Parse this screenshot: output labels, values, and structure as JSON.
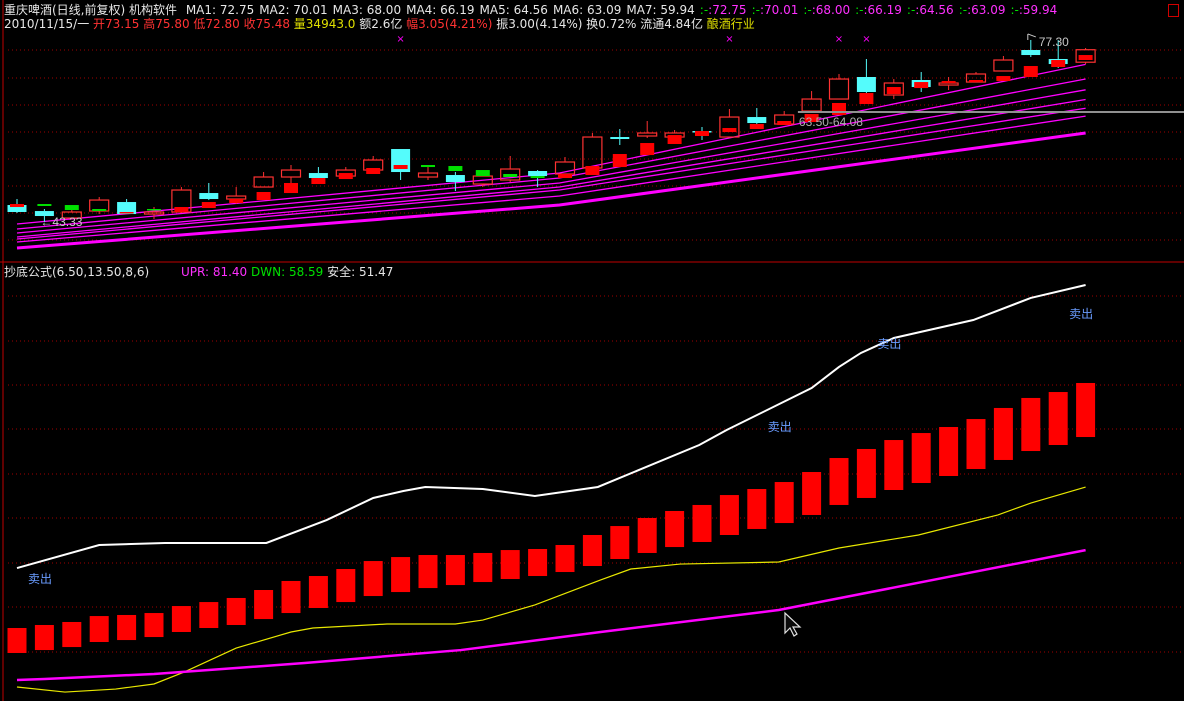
{
  "header": {
    "title": "重庆啤酒(日线,前复权) 机构软件",
    "ma": [
      {
        "label": "MA1: 72.75"
      },
      {
        "label": "MA2: 70.01"
      },
      {
        "label": "MA3: 68.00"
      },
      {
        "label": "MA4: 66.19"
      },
      {
        "label": "MA5: 64.56"
      },
      {
        "label": "MA6: 63.09"
      },
      {
        "label": "MA7: 59.94"
      }
    ],
    "ma_extra": [
      {
        "sep": ":-",
        "value": ":72.75"
      },
      {
        "sep": ":-",
        "value": ":70.01"
      },
      {
        "sep": ":-",
        "value": ":68.00"
      },
      {
        "sep": ":-",
        "value": ":66.19"
      },
      {
        "sep": ":-",
        "value": ":64.56"
      },
      {
        "sep": ":-",
        "value": ":63.09"
      },
      {
        "sep": ":-",
        "value": ":59.94"
      }
    ],
    "row2": {
      "date": "2010/11/15/一",
      "open": "开73.15",
      "high": "高75.80",
      "low": "低72.80",
      "close": "收75.48",
      "volume": "量34943.0",
      "amount": "额2.6亿",
      "change": "幅3.05(4.21%)",
      "amplitude": "振3.00(4.14%)",
      "turnover": "换0.72%",
      "float": "流通4.84亿",
      "industry": "酿酒行业"
    }
  },
  "indicator": {
    "name": "抄底公式(6.50,13.50,8,6)",
    "upr": "UPR: 81.40",
    "dwn": "DWN: 58.59",
    "safe": "安全: 51.47"
  },
  "colors": {
    "up": "#ff3232",
    "down": "#54fcfc",
    "green": "#00e000",
    "ma": "#ff00ff",
    "upr": "#ffffff",
    "dwn": "#e8e800",
    "grid": "#a00000",
    "signal": "#6a9cff"
  },
  "chart_data": [
    {
      "type": "candlestick",
      "title": "重庆啤酒(日线,前复权)",
      "ylim": [
        35.87,
        79.16
      ],
      "grid": true,
      "candles": [
        {
          "o": 46.5,
          "h": 47.62,
          "l": 45.01,
          "c": 45.2
        },
        {
          "o": 45.38,
          "h": 45.76,
          "l": 43.33,
          "c": 44.45
        },
        {
          "o": 44.08,
          "h": 45.57,
          "l": 43.89,
          "c": 45.2
        },
        {
          "o": 45.38,
          "h": 47.99,
          "l": 44.82,
          "c": 47.43
        },
        {
          "o": 47.06,
          "h": 47.62,
          "l": 44.82,
          "c": 44.82
        },
        {
          "o": 44.82,
          "h": 46.13,
          "l": 43.89,
          "c": 45.2
        },
        {
          "o": 45.2,
          "h": 49.86,
          "l": 45.01,
          "c": 49.3
        },
        {
          "o": 48.74,
          "h": 50.61,
          "l": 47.43,
          "c": 47.62
        },
        {
          "o": 47.62,
          "h": 49.86,
          "l": 46.69,
          "c": 48.18
        },
        {
          "o": 49.86,
          "h": 52.66,
          "l": 49.86,
          "c": 51.73
        },
        {
          "o": 51.73,
          "h": 53.97,
          "l": 50.61,
          "c": 53.03
        },
        {
          "o": 52.47,
          "h": 53.59,
          "l": 50.61,
          "c": 51.54
        },
        {
          "o": 51.91,
          "h": 53.59,
          "l": 51.73,
          "c": 53.03
        },
        {
          "o": 53.03,
          "h": 55.65,
          "l": 52.66,
          "c": 54.9
        },
        {
          "o": 56.95,
          "h": 56.95,
          "l": 51.17,
          "c": 52.66
        },
        {
          "o": 51.73,
          "h": 53.97,
          "l": 51.17,
          "c": 52.47
        },
        {
          "o": 52.1,
          "h": 52.66,
          "l": 49.11,
          "c": 50.79
        },
        {
          "o": 50.42,
          "h": 52.66,
          "l": 49.86,
          "c": 51.91
        },
        {
          "o": 51.17,
          "h": 55.65,
          "l": 50.79,
          "c": 53.22
        },
        {
          "o": 52.85,
          "h": 53.03,
          "l": 49.86,
          "c": 51.91
        },
        {
          "o": 52.29,
          "h": 55.46,
          "l": 51.54,
          "c": 54.53
        },
        {
          "o": 53.41,
          "h": 59.94,
          "l": 53.03,
          "c": 59.19
        },
        {
          "o": 59.19,
          "h": 60.68,
          "l": 57.7,
          "c": 58.82
        },
        {
          "o": 59.38,
          "h": 62.18,
          "l": 59.0,
          "c": 59.94
        },
        {
          "o": 59.19,
          "h": 60.5,
          "l": 59.0,
          "c": 59.94
        },
        {
          "o": 60.31,
          "h": 61.06,
          "l": 58.63,
          "c": 60.12
        },
        {
          "o": 59.19,
          "h": 64.42,
          "l": 59.19,
          "c": 62.92
        },
        {
          "o": 62.92,
          "h": 64.6,
          "l": 61.43,
          "c": 61.8
        },
        {
          "o": 61.62,
          "h": 64.04,
          "l": 61.43,
          "c": 63.3
        },
        {
          "o": 64.04,
          "h": 67.77,
          "l": 64.04,
          "c": 66.28
        },
        {
          "o": 66.28,
          "h": 70.95,
          "l": 66.28,
          "c": 70.01
        },
        {
          "o": 70.39,
          "h": 73.75,
          "l": 67.4,
          "c": 67.59
        },
        {
          "o": 67.03,
          "h": 70.01,
          "l": 66.28,
          "c": 69.27
        },
        {
          "o": 69.83,
          "h": 71.32,
          "l": 67.59,
          "c": 68.52
        },
        {
          "o": 68.89,
          "h": 70.39,
          "l": 67.96,
          "c": 69.27
        },
        {
          "o": 69.45,
          "h": 71.32,
          "l": 69.45,
          "c": 70.95
        },
        {
          "o": 71.51,
          "h": 74.31,
          "l": 71.51,
          "c": 73.56
        },
        {
          "o": 75.43,
          "h": 77.3,
          "l": 74.12,
          "c": 74.49
        },
        {
          "o": 73.75,
          "h": 77.3,
          "l": 72.07,
          "c": 72.81
        },
        {
          "o": 73.15,
          "h": 75.8,
          "l": 72.8,
          "c": 75.48
        }
      ],
      "overlay_bars": [
        {
          "top": 46.69,
          "bottom": 46.13,
          "color": "red"
        },
        {
          "top": 46.69,
          "bottom": 46.32,
          "color": "green"
        },
        {
          "top": 46.5,
          "bottom": 45.57,
          "color": "green"
        },
        {
          "top": 45.76,
          "bottom": 45.38,
          "color": "green"
        },
        {
          "top": 45.2,
          "bottom": 45.01,
          "color": "red"
        },
        {
          "top": 45.76,
          "bottom": 45.57,
          "color": "green"
        },
        {
          "top": 46.13,
          "bottom": 45.2,
          "color": "red"
        },
        {
          "top": 47.06,
          "bottom": 45.94,
          "color": "red"
        },
        {
          "top": 47.62,
          "bottom": 46.88,
          "color": "red"
        },
        {
          "top": 48.93,
          "bottom": 47.43,
          "color": "red"
        },
        {
          "top": 50.61,
          "bottom": 48.74,
          "color": "red"
        },
        {
          "top": 51.54,
          "bottom": 50.42,
          "color": "red"
        },
        {
          "top": 52.47,
          "bottom": 51.35,
          "color": "red"
        },
        {
          "top": 53.41,
          "bottom": 52.29,
          "color": "red"
        },
        {
          "top": 53.97,
          "bottom": 53.22,
          "color": "red"
        },
        {
          "top": 53.97,
          "bottom": 53.59,
          "color": "green"
        },
        {
          "top": 53.78,
          "bottom": 52.85,
          "color": "green"
        },
        {
          "top": 53.03,
          "bottom": 51.91,
          "color": "green"
        },
        {
          "top": 52.29,
          "bottom": 51.73,
          "color": "green"
        },
        {
          "top": 51.91,
          "bottom": 51.54,
          "color": "green"
        },
        {
          "top": 52.29,
          "bottom": 51.54,
          "color": "red"
        },
        {
          "top": 53.78,
          "bottom": 52.1,
          "color": "red"
        },
        {
          "top": 56.02,
          "bottom": 53.59,
          "color": "red"
        },
        {
          "top": 58.07,
          "bottom": 55.83,
          "color": "red"
        },
        {
          "top": 59.56,
          "bottom": 57.89,
          "color": "red"
        },
        {
          "top": 60.31,
          "bottom": 59.38,
          "color": "red"
        },
        {
          "top": 60.87,
          "bottom": 60.12,
          "color": "red"
        },
        {
          "top": 61.62,
          "bottom": 60.68,
          "color": "red"
        },
        {
          "top": 62.18,
          "bottom": 61.43,
          "color": "red"
        },
        {
          "top": 63.48,
          "bottom": 61.99,
          "color": "red"
        },
        {
          "top": 65.54,
          "bottom": 63.3,
          "color": "red"
        },
        {
          "top": 67.4,
          "bottom": 65.35,
          "color": "red"
        },
        {
          "top": 68.52,
          "bottom": 67.21,
          "color": "red"
        },
        {
          "top": 69.45,
          "bottom": 68.33,
          "color": "red"
        },
        {
          "top": 69.64,
          "bottom": 69.27,
          "color": "red"
        },
        {
          "top": 69.83,
          "bottom": 69.45,
          "color": "red"
        },
        {
          "top": 70.57,
          "bottom": 69.64,
          "color": "red"
        },
        {
          "top": 72.44,
          "bottom": 70.39,
          "color": "red"
        },
        {
          "top": 73.56,
          "bottom": 72.25,
          "color": "red"
        },
        {
          "top": 74.49,
          "bottom": 73.56,
          "color": "red"
        }
      ],
      "moving_averages": [
        {
          "name": "MA1",
          "points": [
            [
              0,
              42.96
            ],
            [
              19.8,
              52.47
            ],
            [
              39,
              72.75
            ]
          ]
        },
        {
          "name": "MA2",
          "points": [
            [
              0,
              42.03
            ],
            [
              19.8,
              51.54
            ],
            [
              39,
              70.01
            ]
          ]
        },
        {
          "name": "MA3",
          "points": [
            [
              0,
              41.28
            ],
            [
              19.8,
              50.61
            ],
            [
              39,
              68.0
            ]
          ]
        },
        {
          "name": "MA4",
          "points": [
            [
              0,
              40.54
            ],
            [
              19.8,
              49.86
            ],
            [
              39,
              66.19
            ]
          ]
        },
        {
          "name": "MA5",
          "points": [
            [
              0,
              40.16
            ],
            [
              19.8,
              49.3
            ],
            [
              39,
              64.56
            ]
          ]
        },
        {
          "name": "MA6",
          "points": [
            [
              0,
              39.6
            ],
            [
              19.8,
              48.18
            ],
            [
              39,
              63.09
            ]
          ]
        },
        {
          "name": "MA7",
          "points": [
            [
              0,
              38.48
            ],
            [
              19.8,
              46.5
            ],
            [
              39,
              59.94
            ]
          ]
        }
      ],
      "annotations": {
        "low_label": "←43.33",
        "low_index": 1,
        "low_value": 43.33,
        "high_label": "77.30",
        "high_index": 37,
        "high_value": 77.3,
        "range_label": "63.50-64.08",
        "range_line_value": 63.86,
        "range_line_start_index": 28.5,
        "x_markers": [
          14,
          26,
          30,
          31
        ],
        "x_marker_symbol": "×"
      }
    },
    {
      "type": "bar+line",
      "title": "抄底公式(6.50,13.50,8,6)",
      "ylim": [
        34.44,
        83.66
      ],
      "grid": true,
      "bars": [
        {
          "top": 42.68,
          "bottom": 39.86
        },
        {
          "top": 43.02,
          "bottom": 40.19
        },
        {
          "top": 43.36,
          "bottom": 40.53
        },
        {
          "top": 44.03,
          "bottom": 41.1
        },
        {
          "top": 44.15,
          "bottom": 41.32
        },
        {
          "top": 44.37,
          "bottom": 41.66
        },
        {
          "top": 45.16,
          "bottom": 42.23
        },
        {
          "top": 45.61,
          "bottom": 42.68
        },
        {
          "top": 46.07,
          "bottom": 43.02
        },
        {
          "top": 46.97,
          "bottom": 43.69
        },
        {
          "top": 47.99,
          "bottom": 44.37
        },
        {
          "top": 48.55,
          "bottom": 44.94
        },
        {
          "top": 49.34,
          "bottom": 45.61
        },
        {
          "top": 50.24,
          "bottom": 46.29
        },
        {
          "top": 50.69,
          "bottom": 46.74
        },
        {
          "top": 50.92,
          "bottom": 47.19
        },
        {
          "top": 50.92,
          "bottom": 47.53
        },
        {
          "top": 51.15,
          "bottom": 47.87
        },
        {
          "top": 51.48,
          "bottom": 48.21
        },
        {
          "top": 51.6,
          "bottom": 48.55
        },
        {
          "top": 52.05,
          "bottom": 49.0
        },
        {
          "top": 53.18,
          "bottom": 49.68
        },
        {
          "top": 54.19,
          "bottom": 50.47
        },
        {
          "top": 55.1,
          "bottom": 51.15
        },
        {
          "top": 55.89,
          "bottom": 51.82
        },
        {
          "top": 56.57,
          "bottom": 52.39
        },
        {
          "top": 57.69,
          "bottom": 53.18
        },
        {
          "top": 58.37,
          "bottom": 53.86
        },
        {
          "top": 59.16,
          "bottom": 54.53
        },
        {
          "top": 60.29,
          "bottom": 55.44
        },
        {
          "top": 61.87,
          "bottom": 56.57
        },
        {
          "top": 62.89,
          "bottom": 57.36
        },
        {
          "top": 63.9,
          "bottom": 58.26
        },
        {
          "top": 64.69,
          "bottom": 59.05
        },
        {
          "top": 65.37,
          "bottom": 59.84
        },
        {
          "top": 66.27,
          "bottom": 60.63
        },
        {
          "top": 67.52,
          "bottom": 61.65
        },
        {
          "top": 68.65,
          "bottom": 62.66
        },
        {
          "top": 69.32,
          "bottom": 63.34
        },
        {
          "top": 70.34,
          "bottom": 64.24
        }
      ],
      "series": [
        {
          "name": "UPR",
          "points": [
            [
              0,
              49.45
            ],
            [
              3.0,
              52.05
            ],
            [
              5.4,
              52.28
            ],
            [
              9.1,
              52.28
            ],
            [
              11.3,
              54.87
            ],
            [
              13.0,
              57.36
            ],
            [
              14.1,
              58.15
            ],
            [
              14.9,
              58.6
            ],
            [
              17.0,
              58.37
            ],
            [
              18.9,
              57.58
            ],
            [
              21.2,
              58.6
            ],
            [
              22.7,
              60.52
            ],
            [
              24.9,
              63.34
            ],
            [
              25.9,
              65.03
            ],
            [
              29.0,
              69.77
            ],
            [
              30.0,
              72.15
            ],
            [
              30.8,
              73.73
            ],
            [
              32.0,
              75.42
            ],
            [
              34.9,
              77.45
            ],
            [
              37.0,
              79.94
            ],
            [
              39,
              81.4
            ]
          ]
        },
        {
          "name": "DWN",
          "points": [
            [
              0,
              36.02
            ],
            [
              1.75,
              35.45
            ],
            [
              3.6,
              35.79
            ],
            [
              5.0,
              36.36
            ],
            [
              6.1,
              37.71
            ],
            [
              8.0,
              40.42
            ],
            [
              10.0,
              42.23
            ],
            [
              10.8,
              42.68
            ],
            [
              13.5,
              43.13
            ],
            [
              16.0,
              43.13
            ],
            [
              17.0,
              43.58
            ],
            [
              18.9,
              45.28
            ],
            [
              21.3,
              48.1
            ],
            [
              22.4,
              49.34
            ],
            [
              24.2,
              49.9
            ],
            [
              27.8,
              50.13
            ],
            [
              30.0,
              51.71
            ],
            [
              32.9,
              53.18
            ],
            [
              35.8,
              55.44
            ],
            [
              37.0,
              56.79
            ],
            [
              39,
              58.59
            ]
          ]
        },
        {
          "name": "安全",
          "points": [
            [
              0,
              36.81
            ],
            [
              1,
              36.92
            ],
            [
              5,
              37.49
            ],
            [
              10.5,
              38.73
            ],
            [
              16.2,
              40.19
            ],
            [
              21.3,
              42.23
            ],
            [
              27.8,
              44.71
            ],
            [
              39,
              51.47
            ]
          ]
        }
      ],
      "signals": [
        {
          "index": 0.4,
          "value": 47.76,
          "label": "卖出"
        },
        {
          "index": 27.4,
          "value": 64.92,
          "label": "卖出"
        },
        {
          "index": 31.4,
          "value": 74.29,
          "label": "卖出"
        },
        {
          "index": 38.4,
          "value": 77.67,
          "label": "卖出"
        }
      ]
    }
  ]
}
